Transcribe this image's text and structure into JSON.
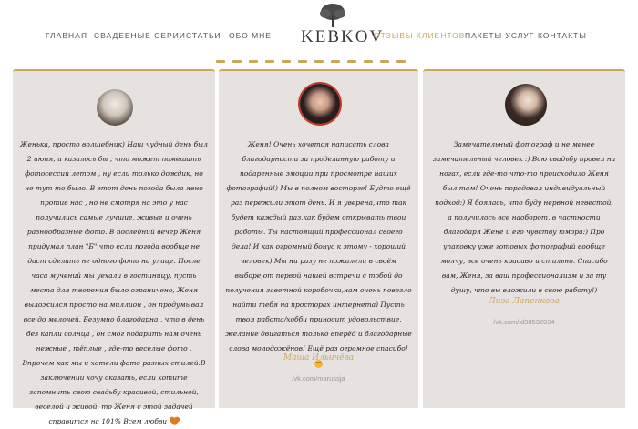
{
  "logo": {
    "text": "KEBKOV"
  },
  "nav": [
    {
      "label": "ГЛАВНАЯ"
    },
    {
      "label": "СВАДЕБНЫЕ СЕРИИ"
    },
    {
      "label": "СТАТЬИ"
    },
    {
      "label": "ОБО МНЕ"
    },
    {
      "label": "ОТЗЫВЫ КЛИЕНТОВ",
      "active": true
    },
    {
      "label": "ПАКЕТЫ УСЛУГ"
    },
    {
      "label": "КОНТАКТЫ"
    }
  ],
  "colors": {
    "accent": "#c9a85a",
    "card_bg": "#e6e2e0",
    "text": "#222222"
  },
  "reviews": [
    {
      "text": "Женька, просто волшебник) Наш чудный день был 2 июня, и казалось бы , что может помешать фотосессии летом , ну если только дождик, но не тут то было. В этот день погода была явно против нас , но не смотря на это у нас получились самые лучшие, живые и очень разнообразные фото. В последний вечер Женя придумал план \"Б\" что если погода вообще не даст сделать не одного фото на улице. После часа мучений мы уехали в гостиницу, пусть места для творения было ограничено, Женя выложился просто на миллион , он продумывал все до мелочей. Безумно благодарна , что в день без капли солнца , он смог подарить нам очень нежные , тёплые , где-то веселые фото . Впрочем как мы и хотели фото разных стилей.В заключении хочу сказать, если хотите запомнить свою свадьбу красивой, стильной, веселой и живой, то Женя с этой задачей справится на 101% Всем любви",
      "author": "",
      "link": ""
    },
    {
      "text": "Женя! Очень хочется написать слова благодарности за проделанную работу и подаренные эмоции при просмотре наших фотографий!) Мы в полном восторге! Будто ещё раз пережили этот день. И я уверена,что так будет каждый раз,как будем открывать твои работы. Ты настоящий профессионал своего дела! И как огромный бонус к этому - хороший человек) Мы ни разу не пожалели в своём выборе,от первой нашей встречи с тобой до получения заветной коробочки,нам очень повезло найти тебя на просторах интернета) Пусть твоя работа/хобби приносит удовольствие, желание двигаться только вперёд и благодарные слова молодожёнов! Ещё раз огромное спасибо!",
      "author": "Маша Ильичёва",
      "link": "/vk.com/marussja"
    },
    {
      "text": "Замечательный фотограф и не менее замечательный человек :) Всю свадьбу провел на ногах, если где-то что-то происходило Женя был там! Очень порадовал индивидуальный подход:) Я боялась, что буду нервной невестой, а получилось все наоборот, в частности благодаря Жене и его чувству юмора:) Про упаковку уже готовых фотографий вообще молчу, все очень красиво и стильно. Спасибо вам, Женя, за ваш профессионализм и за ту душу, что вы вложили в свою работу!)",
      "author": "Лиза Лапенкова",
      "link": "/vk.com/id38532934"
    }
  ]
}
